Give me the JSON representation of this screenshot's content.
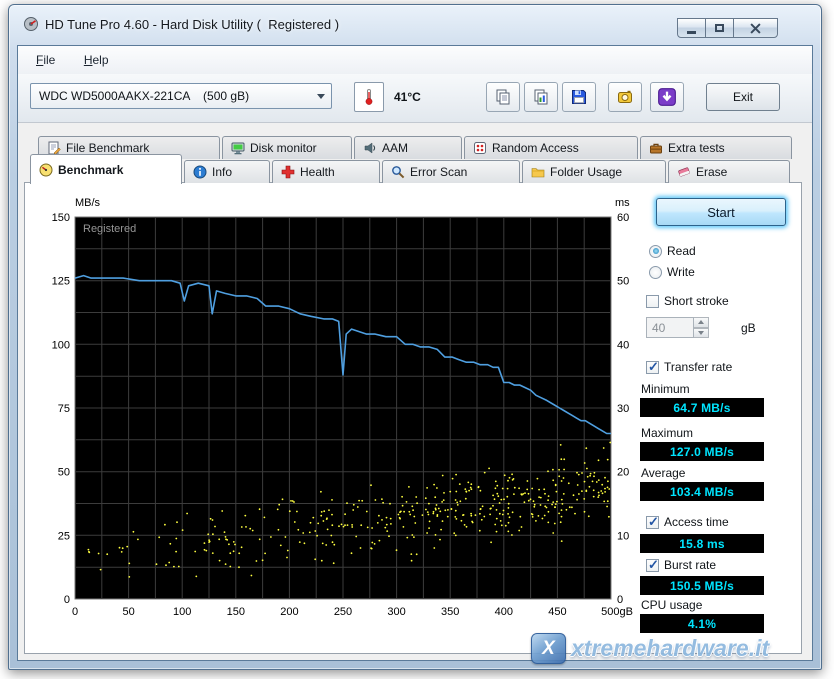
{
  "window": {
    "title": "HD Tune Pro 4.60 - Hard Disk Utility (  Registered )"
  },
  "menu": {
    "items": [
      {
        "label": "File"
      },
      {
        "label": "Help"
      }
    ]
  },
  "toolbar": {
    "drive_select_value": "WDC WD5000AAKX-221CA    (500 gB)",
    "temperature": "41°C",
    "exit_label": "Exit",
    "button_icons": [
      "thermometer-icon",
      "copy-text-icon",
      "copy-screenshot-icon",
      "save-icon",
      "capture-icon",
      "download-icon"
    ]
  },
  "tabs": {
    "row_top": [
      {
        "label": "File Benchmark",
        "icon": "file-benchmark-icon"
      },
      {
        "label": "Disk monitor",
        "icon": "disk-monitor-icon"
      },
      {
        "label": "AAM",
        "icon": "aam-icon"
      },
      {
        "label": "Random Access",
        "icon": "random-access-icon"
      },
      {
        "label": "Extra tests",
        "icon": "extra-tests-icon"
      }
    ],
    "row_bottom": [
      {
        "label": "Benchmark",
        "icon": "benchmark-icon",
        "active": true
      },
      {
        "label": "Info",
        "icon": "info-icon"
      },
      {
        "label": "Health",
        "icon": "health-icon"
      },
      {
        "label": "Error Scan",
        "icon": "error-scan-icon"
      },
      {
        "label": "Folder Usage",
        "icon": "folder-usage-icon"
      },
      {
        "label": "Erase",
        "icon": "erase-icon"
      }
    ]
  },
  "controls": {
    "start_label": "Start",
    "read_label": "Read",
    "read_selected": true,
    "write_label": "Write",
    "write_selected": false,
    "short_stroke_label": "Short stroke",
    "short_stroke_checked": false,
    "short_stroke_value": "40",
    "short_stroke_unit": "gB",
    "transfer_rate_label": "Transfer rate",
    "transfer_rate_checked": true,
    "minimum_label": "Minimum",
    "minimum_value": "64.7 MB/s",
    "maximum_label": "Maximum",
    "maximum_value": "127.0 MB/s",
    "average_label": "Average",
    "average_value": "103.4 MB/s",
    "access_time_label": "Access time",
    "access_time_checked": true,
    "access_time_value": "15.8 ms",
    "burst_rate_label": "Burst rate",
    "burst_rate_checked": true,
    "burst_rate_value": "150.5 MB/s",
    "cpu_usage_label": "CPU usage",
    "cpu_usage_value": "4.1%"
  },
  "chart_data": {
    "type": "line+scatter",
    "overlay_text": "Registered",
    "grid": true,
    "plot_background": "#000000",
    "x_axis": {
      "min": 0,
      "max": 500,
      "ticks": [
        0,
        50,
        100,
        150,
        200,
        250,
        300,
        350,
        400,
        450
      ],
      "last_tick_label": "500gB",
      "minor_grid_step": 25
    },
    "left_axis": {
      "label": "MB/s",
      "min": 0,
      "max": 150,
      "ticks": [
        150,
        125,
        100,
        75,
        50,
        25,
        0
      ],
      "minor_grid_step": 12.5
    },
    "right_axis": {
      "label": "ms",
      "min": 0,
      "max": 60,
      "ticks": [
        60,
        50,
        40,
        30,
        20,
        10,
        0
      ]
    },
    "series": [
      {
        "name": "Transfer rate",
        "type": "line",
        "axis": "left",
        "color": "#4f9fe0",
        "points": [
          [
            0,
            126
          ],
          [
            8,
            127
          ],
          [
            15,
            126
          ],
          [
            30,
            126
          ],
          [
            45,
            126
          ],
          [
            60,
            125
          ],
          [
            75,
            125
          ],
          [
            90,
            125
          ],
          [
            98,
            124
          ],
          [
            102,
            117
          ],
          [
            106,
            123
          ],
          [
            115,
            124
          ],
          [
            125,
            123
          ],
          [
            128,
            112
          ],
          [
            132,
            121
          ],
          [
            140,
            120
          ],
          [
            150,
            119
          ],
          [
            160,
            119
          ],
          [
            170,
            118
          ],
          [
            178,
            115
          ],
          [
            190,
            115
          ],
          [
            200,
            114
          ],
          [
            210,
            112
          ],
          [
            220,
            111
          ],
          [
            232,
            110
          ],
          [
            240,
            110
          ],
          [
            246,
            109
          ],
          [
            250,
            88
          ],
          [
            253,
            104
          ],
          [
            258,
            106
          ],
          [
            265,
            105
          ],
          [
            272,
            104
          ],
          [
            280,
            104
          ],
          [
            290,
            103
          ],
          [
            300,
            103
          ],
          [
            308,
            100
          ],
          [
            315,
            100
          ],
          [
            322,
            99
          ],
          [
            330,
            99
          ],
          [
            338,
            98
          ],
          [
            345,
            95
          ],
          [
            352,
            95
          ],
          [
            358,
            94
          ],
          [
            365,
            93
          ],
          [
            372,
            93
          ],
          [
            378,
            92
          ],
          [
            385,
            92
          ],
          [
            390,
            91
          ],
          [
            395,
            91
          ],
          [
            400,
            85
          ],
          [
            405,
            85
          ],
          [
            410,
            84
          ],
          [
            415,
            84
          ],
          [
            420,
            83
          ],
          [
            425,
            82
          ],
          [
            430,
            80
          ],
          [
            435,
            79
          ],
          [
            440,
            78
          ],
          [
            448,
            76
          ],
          [
            452,
            75
          ],
          [
            456,
            74
          ],
          [
            460,
            73
          ],
          [
            464,
            72
          ],
          [
            468,
            71
          ],
          [
            472,
            70
          ],
          [
            476,
            70
          ],
          [
            480,
            69
          ],
          [
            484,
            68
          ],
          [
            488,
            67
          ],
          [
            492,
            66
          ],
          [
            496,
            65
          ],
          [
            500,
            65
          ]
        ]
      },
      {
        "name": "Access time",
        "type": "scatter",
        "axis": "right",
        "color": "#ffff40",
        "generated": true,
        "seed": 77,
        "count": 430,
        "ms_range": [
          2,
          27
        ],
        "trend": "band rises from about 6 ms near 0 gB to about 18 ms near 500 gB, density increasing toward the right"
      }
    ]
  },
  "watermark": {
    "text": "xtremehardware.it"
  }
}
